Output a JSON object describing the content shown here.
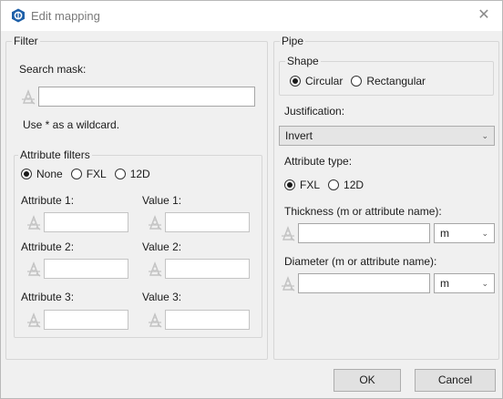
{
  "window": {
    "title": "Edit mapping",
    "close_glyph": "✕",
    "icon": "app-logo-icon"
  },
  "filter": {
    "legend": "Filter",
    "search_mask_label": "Search mask:",
    "search_mask_value": "",
    "wildcard_hint": "Use * as a wildcard.",
    "attribute_filters": {
      "legend": "Attribute filters",
      "options": [
        "None",
        "FXL",
        "12D"
      ],
      "selected": "None",
      "rows": [
        {
          "attr_label": "Attribute 1:",
          "attr_value": "",
          "val_label": "Value 1:",
          "val_value": ""
        },
        {
          "attr_label": "Attribute 2:",
          "attr_value": "",
          "val_label": "Value 2:",
          "val_value": ""
        },
        {
          "attr_label": "Attribute 3:",
          "attr_value": "",
          "val_label": "Value 3:",
          "val_value": ""
        }
      ]
    }
  },
  "pipe": {
    "legend": "Pipe",
    "shape": {
      "legend": "Shape",
      "options": [
        "Circular",
        "Rectangular"
      ],
      "selected": "Circular"
    },
    "justification_label": "Justification:",
    "justification_value": "Invert",
    "attribute_type_label": "Attribute type:",
    "attribute_type_options": [
      "FXL",
      "12D"
    ],
    "attribute_type_selected": "FXL",
    "thickness_label": "Thickness (m or attribute name):",
    "thickness_value": "",
    "thickness_unit": "m",
    "diameter_label": "Diameter (m or attribute name):",
    "diameter_value": "",
    "diameter_unit": "m"
  },
  "buttons": {
    "ok": "OK",
    "cancel": "Cancel"
  },
  "colors": {
    "logo": "#1d5fa8",
    "dialog_bg": "#f0f0f0",
    "button_bg": "#e1e1e1",
    "picker_icon": "#c3c3c3"
  }
}
